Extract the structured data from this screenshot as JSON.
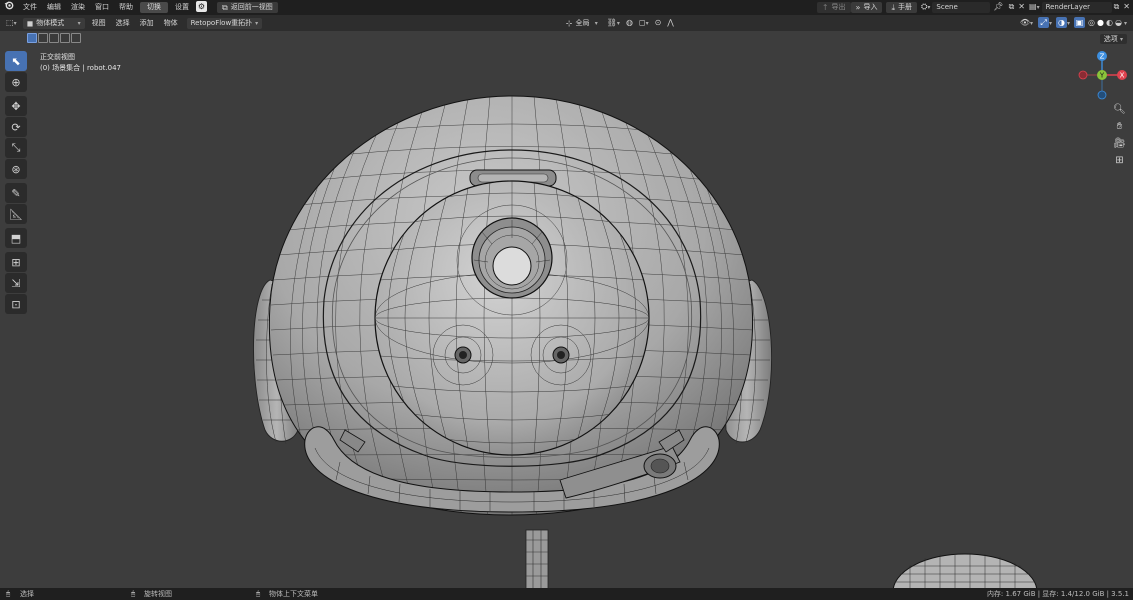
{
  "topbar": {
    "menu": [
      "文件",
      "编辑",
      "渲染",
      "窗口",
      "帮助"
    ],
    "workspace": "切换",
    "settings": "设置",
    "back_button": "返回前一视图",
    "export_label": "导出",
    "import_label": "导入",
    "manual_label": "手册",
    "scene_name": "Scene",
    "render_layer": "RenderLayer"
  },
  "viewport_header": {
    "mode": "物体模式",
    "menus": [
      "视图",
      "选择",
      "添加",
      "物体"
    ],
    "addon_menu": "RetopoFlow重拓扑",
    "transform_orientation": "全局",
    "options": "选项"
  },
  "view_info": {
    "view_name": "正交前视图",
    "collection": "(0) 场景集合 | robot.047"
  },
  "gizmo": {
    "z": "Z",
    "y": "Y",
    "x": "X"
  },
  "statusbar": {
    "select": "选择",
    "rotate_view": "旋转视图",
    "context_menu": "物体上下文菜单",
    "stats": "内存: 1.67 GiB | 显存: 1.4/12.0 GiB | 3.5.1"
  },
  "colors": {
    "accent": "#4772b3",
    "gizmo_x": "#e0424f",
    "gizmo_y": "#8ac33a",
    "gizmo_z": "#3d8fe0"
  }
}
